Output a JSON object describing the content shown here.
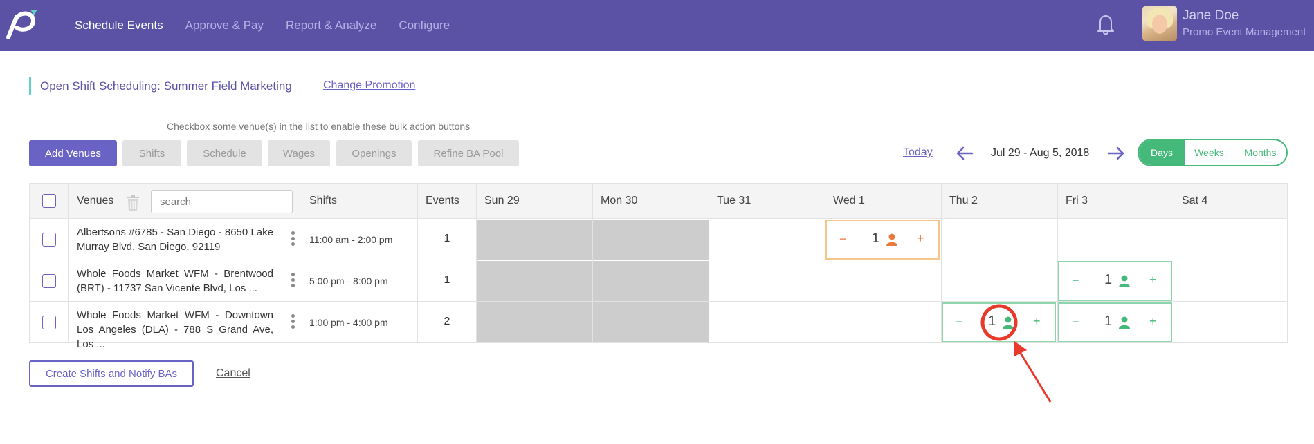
{
  "nav": {
    "items": [
      {
        "label": "Schedule Events",
        "active": true
      },
      {
        "label": "Approve & Pay",
        "active": false
      },
      {
        "label": "Report & Analyze",
        "active": false
      },
      {
        "label": "Configure",
        "active": false
      }
    ]
  },
  "user": {
    "name": "Jane Doe",
    "org": "Promo Event Management"
  },
  "page": {
    "title": "Open Shift Scheduling: Summer Field Marketing",
    "change_link": "Change Promotion",
    "bulk_hint": "Checkbox some venue(s) in the list to enable these bulk action buttons"
  },
  "toolbar": {
    "add_venues": "Add Venues",
    "shifts": "Shifts",
    "schedule": "Schedule",
    "wages": "Wages",
    "openings": "Openings",
    "refine": "Refine BA Pool",
    "today": "Today",
    "date_range": "Jul 29 - Aug 5, 2018",
    "view_days": "Days",
    "view_weeks": "Weeks",
    "view_months": "Months",
    "active_view": "Days"
  },
  "table": {
    "headers": {
      "venues": "Venues",
      "search_placeholder": "search",
      "shifts": "Shifts",
      "events": "Events",
      "days": [
        "Sun 29",
        "Mon 30",
        "Tue 31",
        "Wed 1",
        "Thu 2",
        "Fri 3",
        "Sat 4"
      ]
    },
    "rows": [
      {
        "venue": "Albertsons #6785 - San Diego - 8650 Lake Murray Blvd, San Diego, 92119",
        "shift": "11:00 am - 2:00 pm",
        "events": "1"
      },
      {
        "venue": "Whole Foods Market WFM - Brentwood (BRT) - 11737 San Vicente Blvd, Los ...",
        "shift": "5:00 pm - 8:00 pm",
        "events": "1"
      },
      {
        "venue": "Whole Foods Market WFM - Downtown Los Angeles (DLA) - 788 S Grand Ave, Los ...",
        "shift": "1:00 pm - 4:00 pm",
        "events": "2"
      }
    ],
    "openings": [
      {
        "row": 0,
        "day": "Wed 1",
        "count": "1",
        "state": "orange"
      },
      {
        "row": 1,
        "day": "Fri 3",
        "count": "1",
        "state": "green"
      },
      {
        "row": 2,
        "day": "Thu 2",
        "count": "1",
        "state": "green"
      },
      {
        "row": 2,
        "day": "Fri 3",
        "count": "1",
        "state": "green"
      }
    ],
    "stepper": {
      "minus": "−",
      "plus": "+"
    }
  },
  "footer": {
    "create": "Create Shifts and Notify BAs",
    "cancel": "Cancel"
  },
  "colors": {
    "header_bg": "#5b52a6",
    "accent": "#6a63c6",
    "green": "#45b97a",
    "orange": "#ea7a3c",
    "annotation_red": "#e8392a"
  }
}
